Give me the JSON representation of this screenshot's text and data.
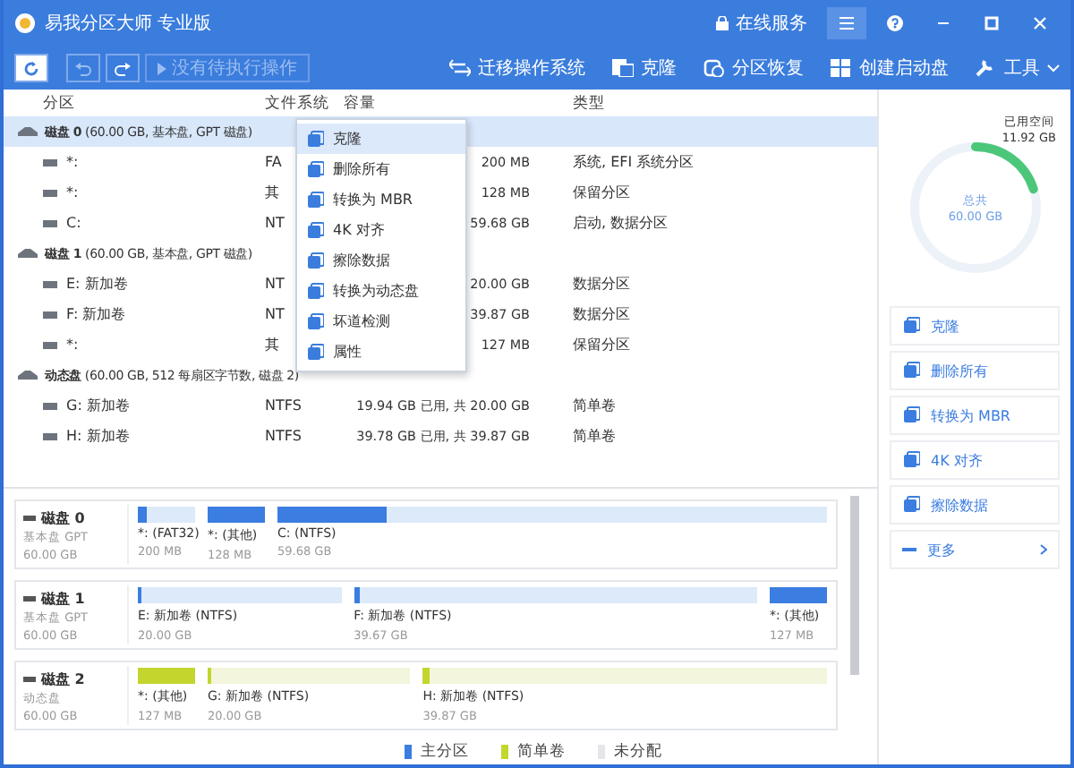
{
  "window": {
    "title": "易我分区大师 专业版"
  },
  "title_bar": {
    "service": "在线服务"
  },
  "toolbar": {
    "pending": "没有待执行操作",
    "actions": [
      {
        "label": "迁移操作系统"
      },
      {
        "label": "克隆"
      },
      {
        "label": "分区恢复"
      },
      {
        "label": "创建启动盘"
      },
      {
        "label": "工具"
      }
    ]
  },
  "table": {
    "columns": [
      "分区",
      "文件系统",
      "容量",
      "类型"
    ],
    "rows": [
      {
        "kind": "disk",
        "name": "**磁盘 0** (60.00 GB, 基本盘, GPT 磁盘)",
        "selected": true
      },
      {
        "kind": "partition",
        "name": "*:",
        "fs": "FA",
        "capacity": "200 MB",
        "type": "系统, EFI 系统分区"
      },
      {
        "kind": "partition",
        "name": "*:",
        "fs": "其",
        "capacity": "128 MB",
        "type": "保留分区"
      },
      {
        "kind": "partition",
        "name": "C:",
        "fs": "NT",
        "capacity": "59.68 GB",
        "type": "启动, 数据分区"
      },
      {
        "kind": "disk",
        "name": "**磁盘 1** (60.00 GB, 基本盘, GPT 磁盘)",
        "selected": false
      },
      {
        "kind": "partition",
        "name": "E: 新加卷",
        "fs": "NT",
        "capacity": "20.00 GB",
        "type": "数据分区"
      },
      {
        "kind": "partition",
        "name": "F: 新加卷",
        "fs": "NT",
        "capacity": "39.87 GB",
        "type": "数据分区"
      },
      {
        "kind": "partition",
        "name": "*:",
        "fs": "其",
        "capacity": "127 MB",
        "type": "保留分区"
      },
      {
        "kind": "disk",
        "name": "**动态盘** (60.00 GB, 512 每扇区字节数, 磁盘 2)",
        "selected": false
      },
      {
        "kind": "partition",
        "name": "G: 新加卷",
        "fs": "NTFS",
        "capacity": "19.94 GB 已用, 共 20.00 GB",
        "type": "简单卷"
      },
      {
        "kind": "partition",
        "name": "H: 新加卷",
        "fs": "NTFS",
        "capacity": "39.78 GB 已用, 共 39.87 GB",
        "type": "简单卷"
      }
    ]
  },
  "context_menu": {
    "items": [
      {
        "label": "克隆",
        "selected": true
      },
      {
        "label": "删除所有",
        "selected": false
      },
      {
        "label": "转换为 MBR",
        "selected": false
      },
      {
        "label": "4K 对齐",
        "selected": false
      },
      {
        "label": "擦除数据",
        "selected": false
      },
      {
        "label": "转换为动态盘",
        "selected": false
      },
      {
        "label": "坏道检测",
        "selected": false
      },
      {
        "label": "属性",
        "selected": false
      }
    ]
  },
  "usage": {
    "used_label": "已用空间",
    "used": "11.92 GB",
    "total_label": "总共",
    "total": "60.00 GB",
    "level": 0.2
  },
  "actions": [
    {
      "label": "克隆",
      "kind": "action"
    },
    {
      "label": "删除所有",
      "kind": "action"
    },
    {
      "label": "转换为 MBR",
      "kind": "action"
    },
    {
      "label": "4K 对齐",
      "kind": "action"
    },
    {
      "label": "擦除数据",
      "kind": "action"
    },
    {
      "label": "更多",
      "kind": "more"
    }
  ],
  "disk_map": {
    "disks": [
      {
        "name": "磁盘 0",
        "type": "基本盘 GPT",
        "size": "60.00 GB",
        "partitions": [
          {
            "label": "*: (FAT32)",
            "size": "200 MB",
            "kind": "primary",
            "level": 0.15
          },
          {
            "label": "*: (其他)",
            "size": "128 MB",
            "kind": "primary",
            "level": 1
          },
          {
            "label": "C: (NTFS)",
            "size": "59.68 GB",
            "kind": "primary",
            "level": 0.2
          }
        ]
      },
      {
        "name": "磁盘 1",
        "type": "基本盘 GPT",
        "size": "60.00 GB",
        "partitions": [
          {
            "label": "E: 新加卷 (NTFS)",
            "size": "20.00 GB",
            "kind": "primary",
            "level": 0.01
          },
          {
            "label": "F: 新加卷 (NTFS)",
            "size": "39.67 GB",
            "kind": "primary",
            "level": 0.01
          },
          {
            "label": "*: (其他)",
            "size": "127 MB",
            "kind": "primary",
            "level": 1
          }
        ]
      },
      {
        "name": "磁盘 2",
        "type": "动态盘",
        "size": "60.00 GB",
        "partitions": [
          {
            "label": "*: (其他)",
            "size": "127 MB",
            "kind": "simple",
            "level": 1
          },
          {
            "label": "G: 新加卷 (NTFS)",
            "size": "20.00 GB",
            "kind": "simple",
            "level": 0.01
          },
          {
            "label": "H: 新加卷 (NTFS)",
            "size": "39.87 GB",
            "kind": "simple",
            "level": 0.01
          }
        ]
      }
    ]
  },
  "legend": [
    {
      "label": "主分区",
      "color": "#3b7de0"
    },
    {
      "label": "简单卷",
      "color": "#c2d62e"
    },
    {
      "label": "未分配",
      "color": "#e4e6ea"
    }
  ]
}
